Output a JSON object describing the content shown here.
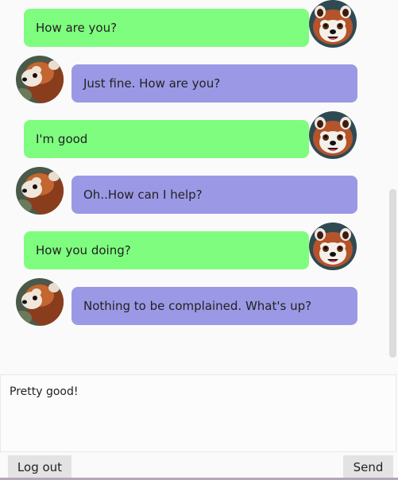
{
  "chat": {
    "messages": [
      {
        "sender": "me",
        "text": "How are you?"
      },
      {
        "sender": "them",
        "text": "Just fine. How are you?"
      },
      {
        "sender": "me",
        "text": "I'm good"
      },
      {
        "sender": "them",
        "text": "Oh..How can I help?"
      },
      {
        "sender": "me",
        "text": "How you doing?"
      },
      {
        "sender": "them",
        "text": "Nothing to be complained. What's up?"
      }
    ]
  },
  "composer": {
    "value": "Pretty good!"
  },
  "buttons": {
    "logout_label": "Log out",
    "send_label": "Send"
  },
  "colors": {
    "my_bubble": "#7ffd7f",
    "their_bubble": "#9b99e5"
  },
  "icons": {
    "my_avatar": "red-panda-face-avatar",
    "their_avatar": "red-panda-side-avatar"
  }
}
